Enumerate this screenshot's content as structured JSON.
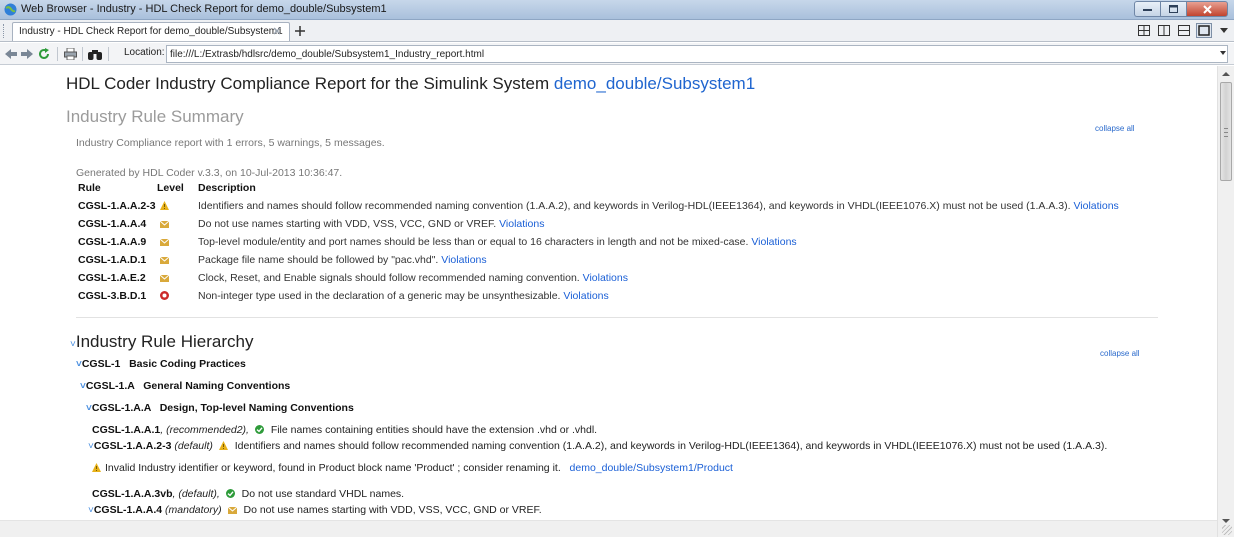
{
  "window": {
    "title": "Web Browser - Industry - HDL Check Report for demo_double/Subsystem1"
  },
  "tab": {
    "label": "Industry - HDL Check Report for demo_double/Subsystem1"
  },
  "toolbar": {
    "location_label": "Location:",
    "location_value": "file:///L:/Extrasb/hdlsrc/demo_double/Subsystem1_Industry_report.html"
  },
  "report": {
    "title_prefix": "HDL Coder Industry Compliance Report for the Simulink System",
    "title_link": "demo_double/Subsystem1",
    "summary_heading": "Industry Rule Summary",
    "summary_text": "Industry Compliance report with 1 errors, 5 warnings, 5 messages.",
    "collapse_all_1": "collapse all",
    "generated_text": "Generated by HDL Coder v.3.3, on 10-Jul-2013 10:36:47.",
    "headers": {
      "rule": "Rule",
      "level": "Level",
      "description": "Description"
    },
    "rules": [
      {
        "id": "CGSL-1.A.A.2-3",
        "level": "warning",
        "description": "Identifiers and names should follow recommended naming convention (1.A.A.2), and keywords in Verilog-HDL(IEEE1364), and keywords in VHDL(IEEE1076.X) must not be used (1.A.A.3).",
        "link": "Violations"
      },
      {
        "id": "CGSL-1.A.A.4",
        "level": "message",
        "description": "Do not use names starting with VDD, VSS, VCC, GND or VREF.",
        "link": "Violations"
      },
      {
        "id": "CGSL-1.A.A.9",
        "level": "message",
        "description": "Top-level module/entity and port names should be less than or equal to 16 characters in length and not be mixed-case.",
        "link": "Violations"
      },
      {
        "id": "CGSL-1.A.D.1",
        "level": "message",
        "description": "Package file name should be followed by \"pac.vhd\".",
        "link": "Violations"
      },
      {
        "id": "CGSL-1.A.E.2",
        "level": "message",
        "description": "Clock, Reset, and Enable signals should follow recommended naming convention.",
        "link": "Violations"
      },
      {
        "id": "CGSL-3.B.D.1",
        "level": "error",
        "description": "Non-integer type used in the declaration of a generic may be unsynthesizable.",
        "link": "Violations"
      }
    ],
    "hierarchy_heading": "Industry Rule Hierarchy",
    "collapse_all_2": "collapse all",
    "hierarchy": {
      "l1": "CGSL-1   Basic Coding Practices",
      "l2": "CGSL-1.A   General Naming Conventions",
      "l3": "CGSL-1.A.A   Design, Top-level Naming Conventions",
      "item1_id": "CGSL-1.A.A.1",
      "item1_level": ", (recommended2),",
      "item1_text": "File names containing entities should have the extension .vhd or .vhdl.",
      "item2_id": "CGSL-1.A.A.2-3",
      "item2_level": "(default)",
      "item2_text": "Identifiers and names should follow recommended naming convention (1.A.A.2), and keywords in Verilog-HDL(IEEE1364), and keywords in VHDL(IEEE1076.X) must not be used (1.A.A.3).",
      "item2_detail": "Invalid Industry identifier or keyword, found in Product block name 'Product' ; consider renaming it.",
      "item2_detail_link": "demo_double/Subsystem1/Product",
      "item3_id": "CGSL-1.A.A.3vb",
      "item3_level": ", (default),",
      "item3_text": "Do not use standard VHDL names.",
      "item4_id": "CGSL-1.A.A.4",
      "item4_level": "(mandatory)",
      "item4_text": "Do not use names starting with VDD, VSS, VCC, GND or VREF."
    }
  },
  "colors": {
    "link": "#1a5fd6",
    "warning": "#e8b21a",
    "message": "#d9a93b",
    "error": "#cc2a2a",
    "pass": "#2e9b3a"
  }
}
